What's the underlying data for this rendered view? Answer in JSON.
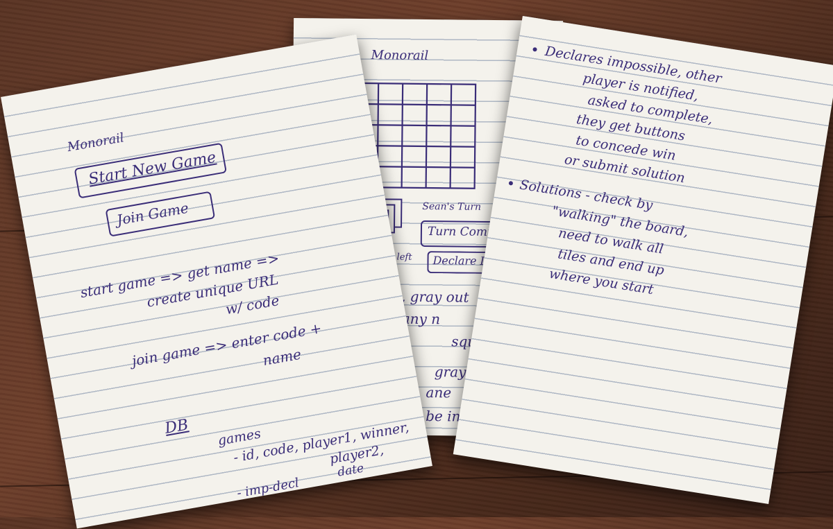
{
  "left_sheet": {
    "title": "Monorail",
    "start_button": "Start New Game",
    "join_button": "Join Game",
    "note1_line1": "start game => get name =>",
    "note1_line2": "create unique URL",
    "note1_line3": "w/ code",
    "note2_line1": "join game => enter code +",
    "note2_line2": "name",
    "db_label": "DB",
    "db_games": "games",
    "db_fields1": "- id, code, player1, winner,",
    "db_fields2": "player2,",
    "db_fields3": "date",
    "db_bottom": "- imp-decl"
  },
  "middle_sheet": {
    "title": "Monorail",
    "turn_label": "Sean's Turn",
    "turn_complete": "Turn Complete",
    "declare_button": "Declare Impos",
    "tiles_left": "tiles left",
    "note1_line1": "drag, gray out",
    "note1_line2": "le's (any n",
    "note1_line3": "squ",
    "note2_line1": "gray",
    "note2_line2": "ane",
    "note2_line3": "be in line"
  },
  "right_sheet": {
    "lines": [
      "Declares impossible, other",
      "player is notified,",
      "asked to complete,",
      "they get buttons",
      "to concede win",
      "or submit solution",
      "Solutions - check by",
      "\"walking\" the board,",
      "need to walk all",
      "tiles and end up",
      "where you start"
    ]
  },
  "colors": {
    "ink": "#3a2d78",
    "paper": "#f4f2ec",
    "table": "#5a3424"
  }
}
